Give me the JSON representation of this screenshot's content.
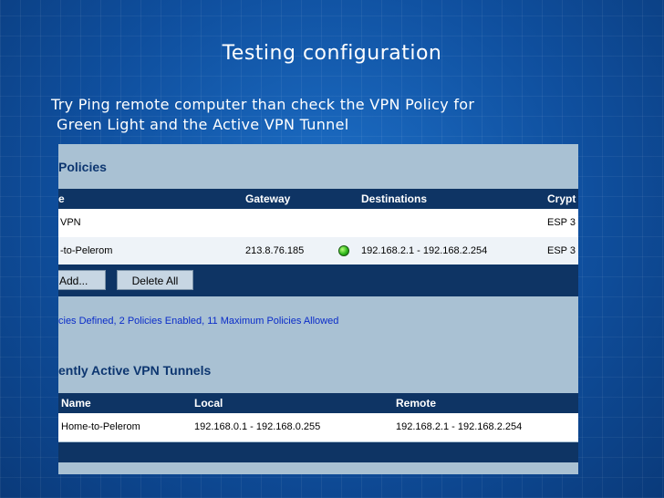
{
  "slide": {
    "title": "Testing configuration",
    "text_line1": "Try Ping remote computer than check the VPN Policy for",
    "text_line2": "Green Light and the Active VPN Tunnel"
  },
  "policies": {
    "title": "Policies",
    "columns": [
      "e",
      "Gateway",
      "Destinations",
      "Crypt"
    ],
    "rows": [
      {
        "name": "VPN",
        "gateway": "",
        "destinations": "",
        "crypto": "ESP 3"
      },
      {
        "name": "-to-Pelerom",
        "gateway": "213.8.76.185",
        "status_icon": "green-status-icon",
        "destinations": "192.168.2.1 - 192.168.2.254",
        "crypto": "ESP 3"
      }
    ],
    "add_label": "Add...",
    "delete_all_label": "Delete All",
    "summary": "cies Defined, 2 Policies Enabled, 11 Maximum Policies Allowed"
  },
  "tunnels": {
    "title": "ently Active VPN Tunnels",
    "columns": [
      "Name",
      "Local",
      "Remote"
    ],
    "rows": [
      {
        "name": "Home-to-Pelerom",
        "local": "192.168.0.1 - 192.168.0.255",
        "remote": "192.168.2.1 - 192.168.2.254"
      }
    ]
  },
  "colors": {
    "header_bg": "#0e3464",
    "panel_bg": "#a9c1d3",
    "status_green": "#2fb81c",
    "summary_text": "#0a2cc9"
  }
}
